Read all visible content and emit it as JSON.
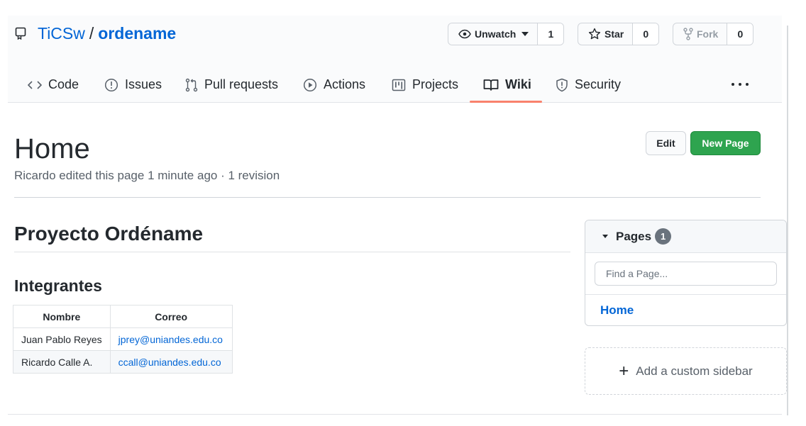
{
  "repo": {
    "owner": "TiCSw",
    "separator": "/",
    "name": "ordename"
  },
  "actions": {
    "unwatch": {
      "label": "Unwatch",
      "count": "1"
    },
    "star": {
      "label": "Star",
      "count": "0"
    },
    "fork": {
      "label": "Fork",
      "count": "0"
    }
  },
  "tabs": [
    {
      "label": "Code",
      "icon": "code-icon"
    },
    {
      "label": "Issues",
      "icon": "issue-opened-icon"
    },
    {
      "label": "Pull requests",
      "icon": "git-pull-request-icon"
    },
    {
      "label": "Actions",
      "icon": "play-icon"
    },
    {
      "label": "Projects",
      "icon": "project-icon"
    },
    {
      "label": "Wiki",
      "icon": "book-icon",
      "selected": true
    },
    {
      "label": "Security",
      "icon": "shield-icon"
    }
  ],
  "page": {
    "title": "Home",
    "meta": "Ricardo edited this page 1 minute ago · 1 revision",
    "edit_label": "Edit",
    "new_page_label": "New Page"
  },
  "content": {
    "heading": "Proyecto Ordéname",
    "subheading": "Integrantes",
    "table": {
      "headers": [
        "Nombre",
        "Correo"
      ],
      "rows": [
        [
          "Juan Pablo Reyes",
          "jprey@uniandes.edu.co"
        ],
        [
          "Ricardo Calle A.",
          "ccall@uniandes.edu.co"
        ]
      ]
    }
  },
  "sidebar": {
    "pages_label": "Pages",
    "pages_count": "1",
    "find_placeholder": "Find a Page...",
    "pages": [
      "Home"
    ],
    "custom_sidebar_label": "Add a custom sidebar"
  },
  "colors": {
    "link": "#0366d6",
    "primary_button": "#2ea44f",
    "selected_tab_underline": "#f9826c",
    "counter_badge": "#6a737d"
  }
}
